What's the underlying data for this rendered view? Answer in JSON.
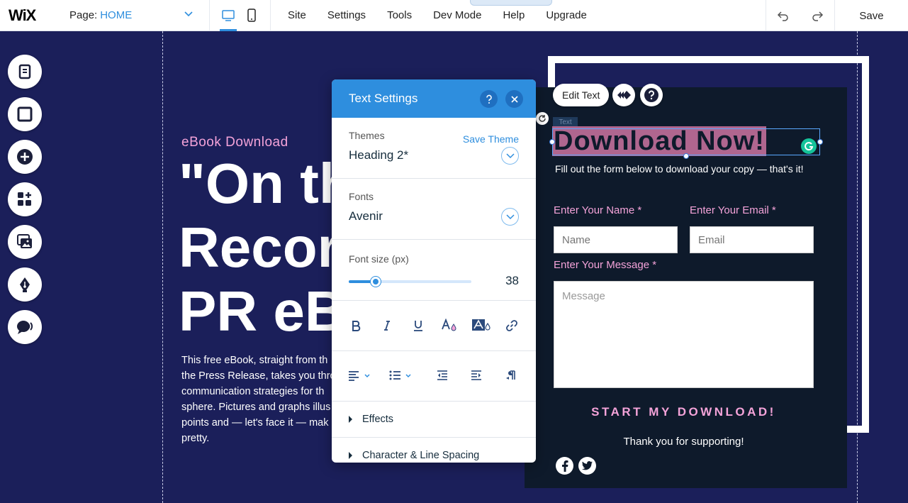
{
  "topbar": {
    "logo": "WiX",
    "page_prefix": "Page:",
    "page_name": "HOME",
    "menu": [
      "Site",
      "Settings",
      "Tools",
      "Dev Mode",
      "Help",
      "Upgrade"
    ],
    "save_label": "Save"
  },
  "sidebar": {
    "items": [
      {
        "icon": "pages-icon"
      },
      {
        "icon": "background-icon"
      },
      {
        "icon": "add-icon"
      },
      {
        "icon": "add-apps-icon"
      },
      {
        "icon": "media-icon"
      },
      {
        "icon": "blog-pen-icon"
      },
      {
        "icon": "wix-bookings-icon"
      }
    ]
  },
  "canvas": {
    "ebook_label": "eBook Download",
    "hero_title": "\"On th\nRecor\nPR eB",
    "body_copy": "This free eBook, straight from th\nthe Press Release, takes you thro\ncommunication strategies for th\nsphere. Pictures and graphs illus\npoints and — let's face it — mak\npretty."
  },
  "form": {
    "edit_text_label": "Edit Text",
    "text_tag": "Text",
    "title": "Download Now!",
    "subtitle": "Fill out the form below to download your copy — that's it!",
    "name_label": "Enter Your Name *",
    "email_label": "Enter Your Email *",
    "message_label": "Enter Your Message *",
    "name_placeholder": "Name",
    "email_placeholder": "Email",
    "message_placeholder": "Message",
    "submit_label": "START MY DOWNLOAD!",
    "thanks": "Thank you for supporting!"
  },
  "text_settings": {
    "title": "Text Settings",
    "themes_label": "Themes",
    "save_theme": "Save Theme",
    "theme_value": "Heading 2*",
    "fonts_label": "Fonts",
    "font_value": "Avenir",
    "font_size_label": "Font size (px)",
    "font_size_value": "38",
    "font_size_slider_fraction": 0.22,
    "effects_label": "Effects",
    "spacing_label": "Character & Line Spacing"
  },
  "colors": {
    "accent": "#2e8ede",
    "canvas_bg": "#1b1f5a",
    "pink": "#f4a3d9",
    "form_bg": "#0e1a2b",
    "highlight": "#b0668f"
  }
}
